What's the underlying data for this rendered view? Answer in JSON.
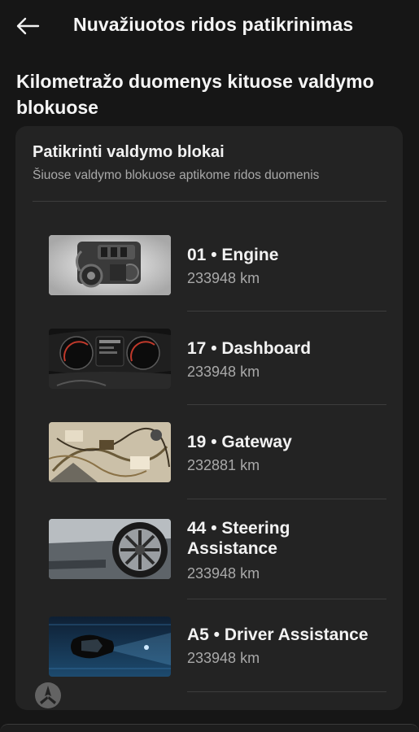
{
  "appbar": {
    "back_icon": "arrow-left-icon",
    "title": "Nuvažiuotos ridos patikrinimas"
  },
  "section": {
    "title": "Kilometražo duomenys kituose valdymo blokuose"
  },
  "card": {
    "title": "Patikrinti valdymo blokai",
    "subtitle": "Šiuose valdymo blokuose aptikome ridos duomenis",
    "modules": [
      {
        "label": "01 • Engine",
        "km": "233948 km",
        "image": "engine-photo"
      },
      {
        "label": "17 • Dashboard",
        "km": "233948 km",
        "image": "dashboard-photo"
      },
      {
        "label": "19 • Gateway",
        "km": "232881 km",
        "image": "gateway-wiring-photo"
      },
      {
        "label": "44 • Steering Assistance",
        "km": "233948 km",
        "image": "wheel-photo"
      },
      {
        "label": "A5 • Driver Assistance",
        "km": "233948 km",
        "image": "driver-assistance-photo"
      }
    ]
  },
  "colors": {
    "background": "#161616",
    "card": "#232323",
    "text_primary": "#f2f2f2",
    "text_secondary": "#a9a9a9",
    "divider": "#3d3d3d"
  }
}
